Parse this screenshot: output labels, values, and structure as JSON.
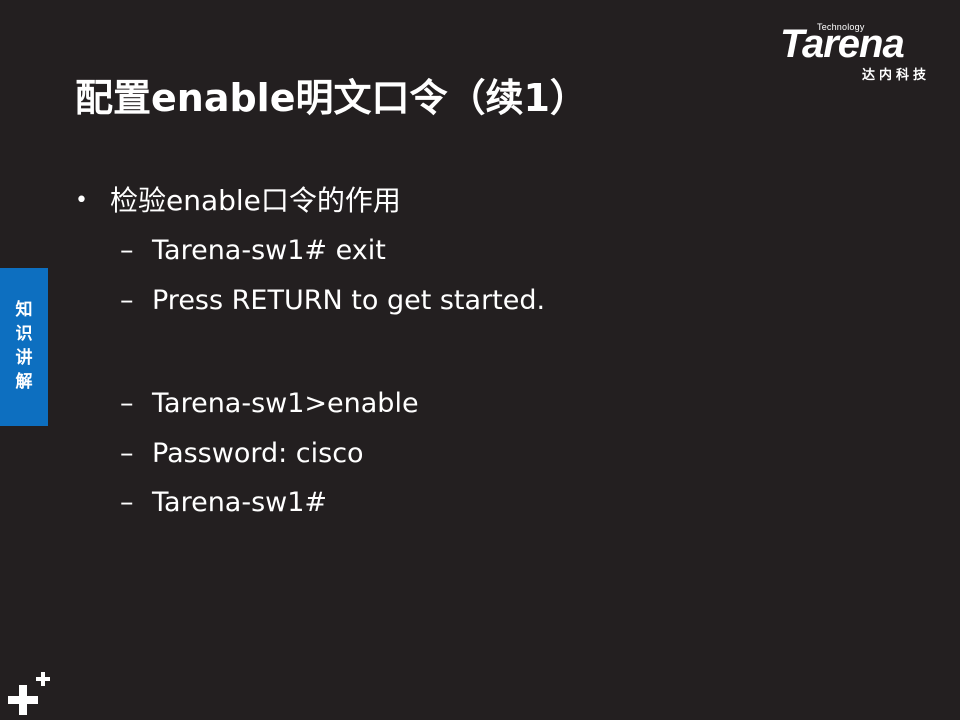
{
  "logo": {
    "technology": "Technology",
    "brand": "Tarena",
    "chinese": "达内科技"
  },
  "slide": {
    "title": "配置enable明文口令（续1）",
    "bullet": {
      "text": "检验enable口令的作用"
    },
    "group1": [
      "Tarena-sw1# exit",
      "Press RETURN to get started."
    ],
    "group2": [
      "Tarena-sw1>enable",
      "Password: cisco",
      "Tarena-sw1#"
    ]
  },
  "side_tab": {
    "label": "知识讲解"
  },
  "colors": {
    "background": "#231f20",
    "tab_blue": "#0d6fc0",
    "text": "#ffffff"
  },
  "icons": {
    "bullet": "bullet-dot-icon",
    "dash": "en-dash",
    "corner": "plus-icon"
  }
}
